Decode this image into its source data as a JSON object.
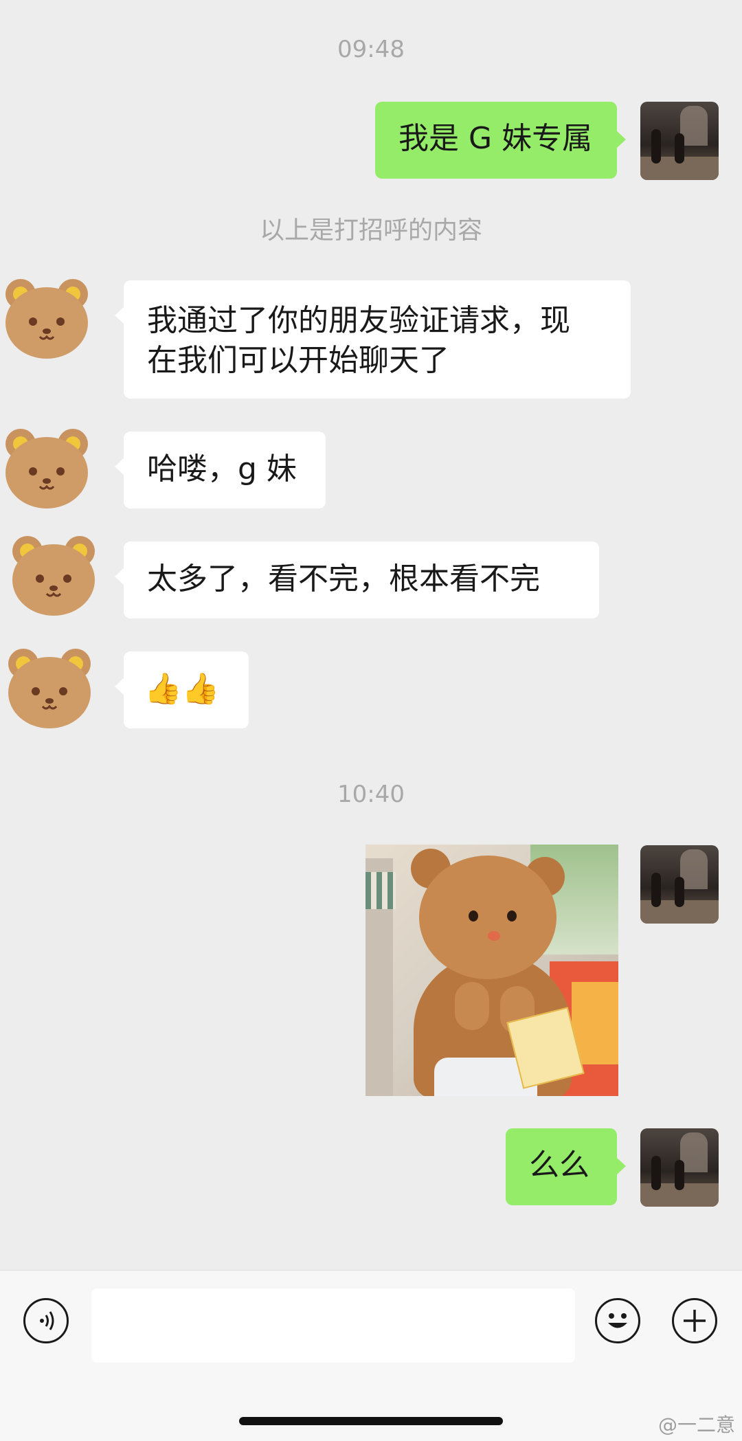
{
  "timestamps": [
    "09:48",
    "10:40"
  ],
  "system_note": "以上是打招呼的内容",
  "messages": [
    {
      "from": "self",
      "text": "我是 G 妹专属"
    },
    {
      "from": "other",
      "line1": "我通过了你的朋友验证请求，现",
      "line2": "在我们可以开始聊天了"
    },
    {
      "from": "other",
      "text": "哈喽，g 妹"
    },
    {
      "from": "other",
      "text": "太多了，看不完，根本看不完"
    },
    {
      "from": "other",
      "text": "👍👍"
    },
    {
      "from": "self",
      "type": "image"
    },
    {
      "from": "self",
      "text": "么么"
    }
  ],
  "input": {
    "value": "",
    "placeholder": ""
  },
  "icons": {
    "voice": "voice-icon",
    "emoji": "emoji-icon",
    "add": "plus-icon"
  },
  "watermark": "@一二意",
  "colors": {
    "self_bubble": "#95ec69",
    "other_bubble": "#ffffff",
    "background": "#ededed"
  }
}
